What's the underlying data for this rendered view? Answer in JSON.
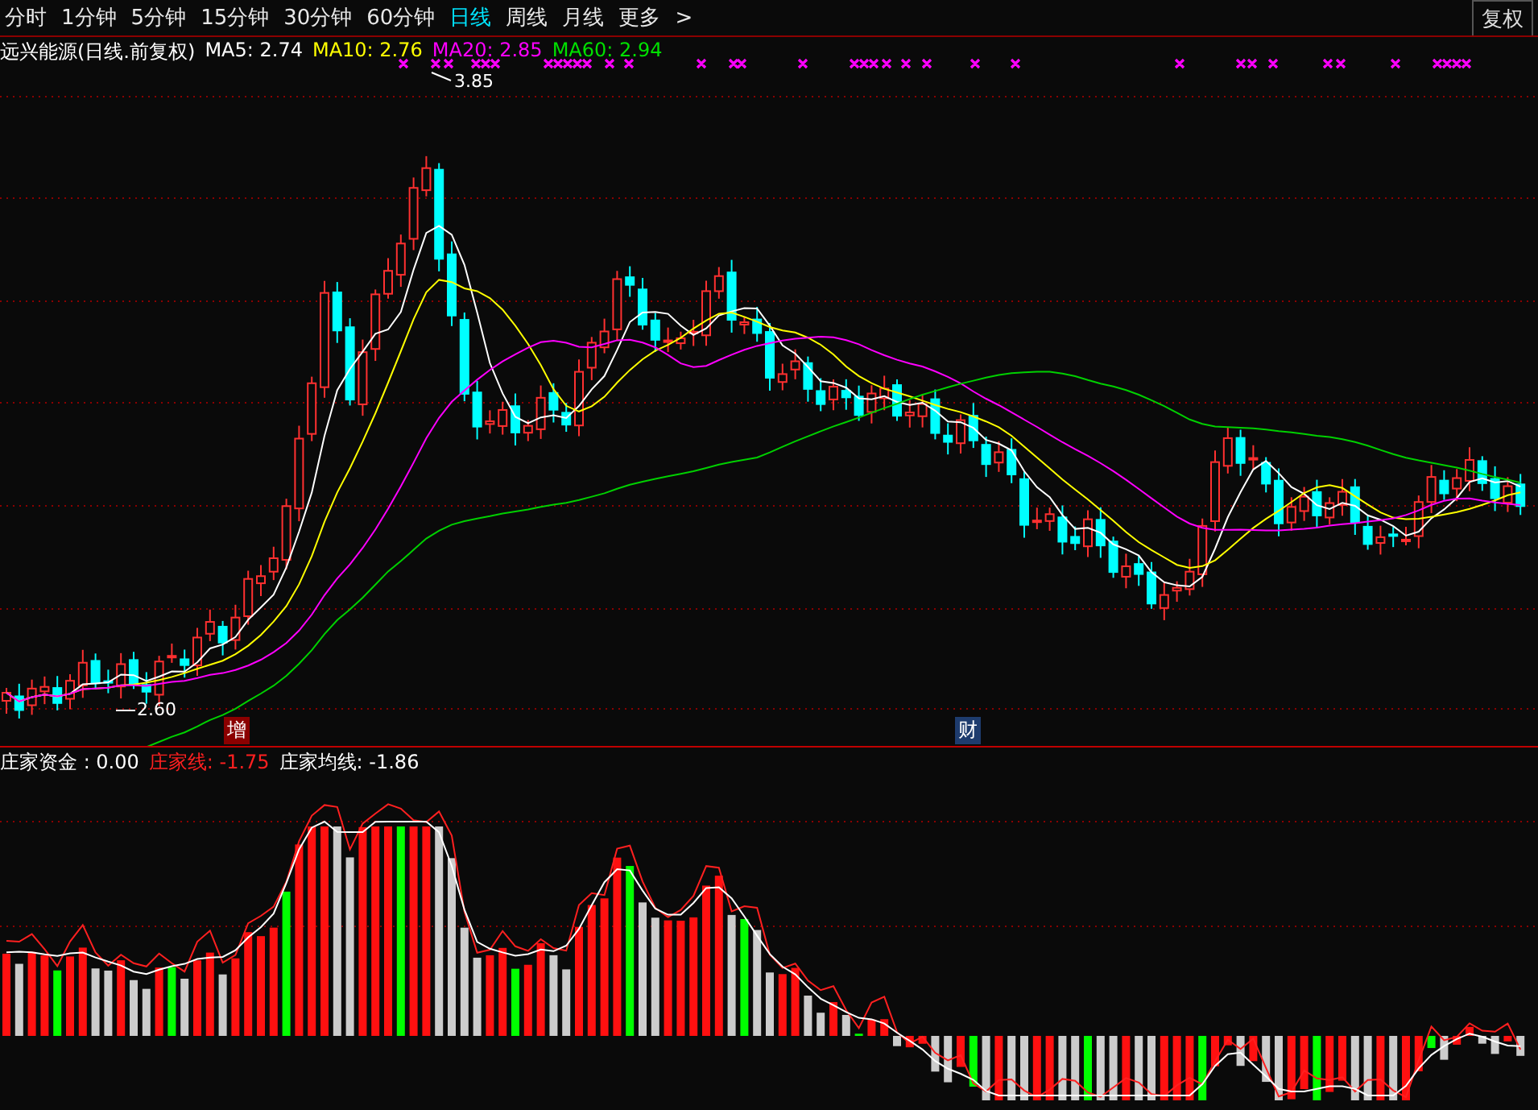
{
  "toolbar": {
    "tabs": [
      {
        "label": "分时",
        "selected": false
      },
      {
        "label": "1分钟",
        "selected": false
      },
      {
        "label": "5分钟",
        "selected": false
      },
      {
        "label": "15分钟",
        "selected": false
      },
      {
        "label": "30分钟",
        "selected": false
      },
      {
        "label": "60分钟",
        "selected": false
      },
      {
        "label": "日线",
        "selected": true
      },
      {
        "label": "周线",
        "selected": false
      },
      {
        "label": "月线",
        "selected": false
      }
    ],
    "more": "更多",
    "more_arrow": ">",
    "restore_button": "复权"
  },
  "legend": {
    "title": "远兴能源(日线.前复权)",
    "items": [
      {
        "label": "MA5: 2.74",
        "color": "#ffffff"
      },
      {
        "label": "MA10: 2.76",
        "color": "#ffff00"
      },
      {
        "label": "MA20: 2.85",
        "color": "#ff00ff"
      },
      {
        "label": "MA60: 2.94",
        "color": "#00e000"
      }
    ]
  },
  "price_labels": [
    {
      "kind": "high",
      "text": "3.85"
    },
    {
      "kind": "low",
      "text": "2.60"
    }
  ],
  "event_markers": [
    {
      "text": "增",
      "color": "#8b0000"
    },
    {
      "text": "财",
      "color": "#1e3c6e"
    }
  ],
  "indicator_legend": [
    {
      "label": "庄家资金 : 0.00",
      "color": "#ffffff"
    },
    {
      "label": "庄家线: -1.75",
      "color": "#ff2020"
    },
    {
      "label": "庄家均线: -1.86",
      "color": "#ffffff"
    }
  ]
}
